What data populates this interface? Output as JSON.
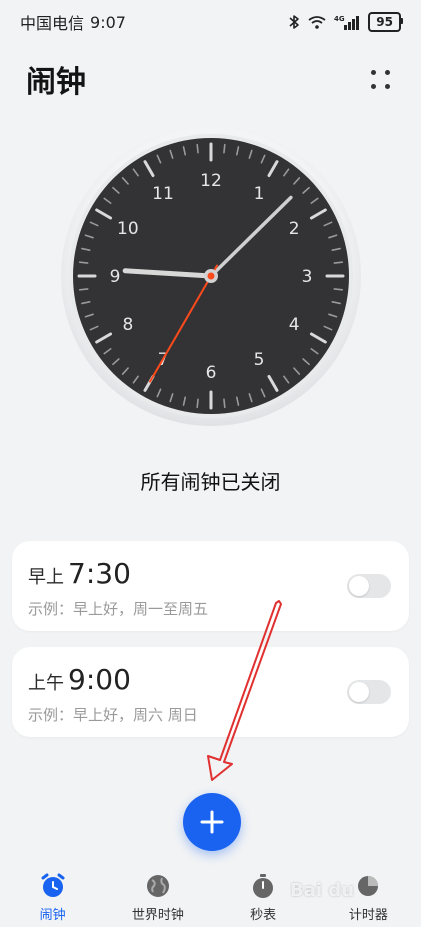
{
  "status_bar": {
    "carrier": "中国电信",
    "time": "9:07",
    "network": "4G",
    "battery": "95"
  },
  "header": {
    "title": "闹钟"
  },
  "clock": {
    "numbers": [
      "12",
      "1",
      "2",
      "3",
      "4",
      "5",
      "6",
      "7",
      "8",
      "9",
      "10",
      "11"
    ],
    "hour": 9,
    "minute": 7,
    "second": 35
  },
  "status_text": "所有闹钟已关闭",
  "alarms": [
    {
      "period": "早上",
      "time": "7:30",
      "desc": "示例：早上好，周一至周五",
      "enabled": false
    },
    {
      "period": "上午",
      "time": "9:00",
      "desc": "示例：早上好，周六 周日",
      "enabled": false
    }
  ],
  "bottom_nav": [
    {
      "label": "闹钟",
      "icon": "alarm-clock-icon",
      "active": true
    },
    {
      "label": "世界时钟",
      "icon": "globe-icon",
      "active": false
    },
    {
      "label": "秒表",
      "icon": "stopwatch-icon",
      "active": false
    },
    {
      "label": "计时器",
      "icon": "timer-icon",
      "active": false
    }
  ],
  "colors": {
    "accent": "#1a63f0",
    "annotation": "#e03030",
    "second_hand": "#ff4a1c",
    "clock_face": "#333335"
  }
}
